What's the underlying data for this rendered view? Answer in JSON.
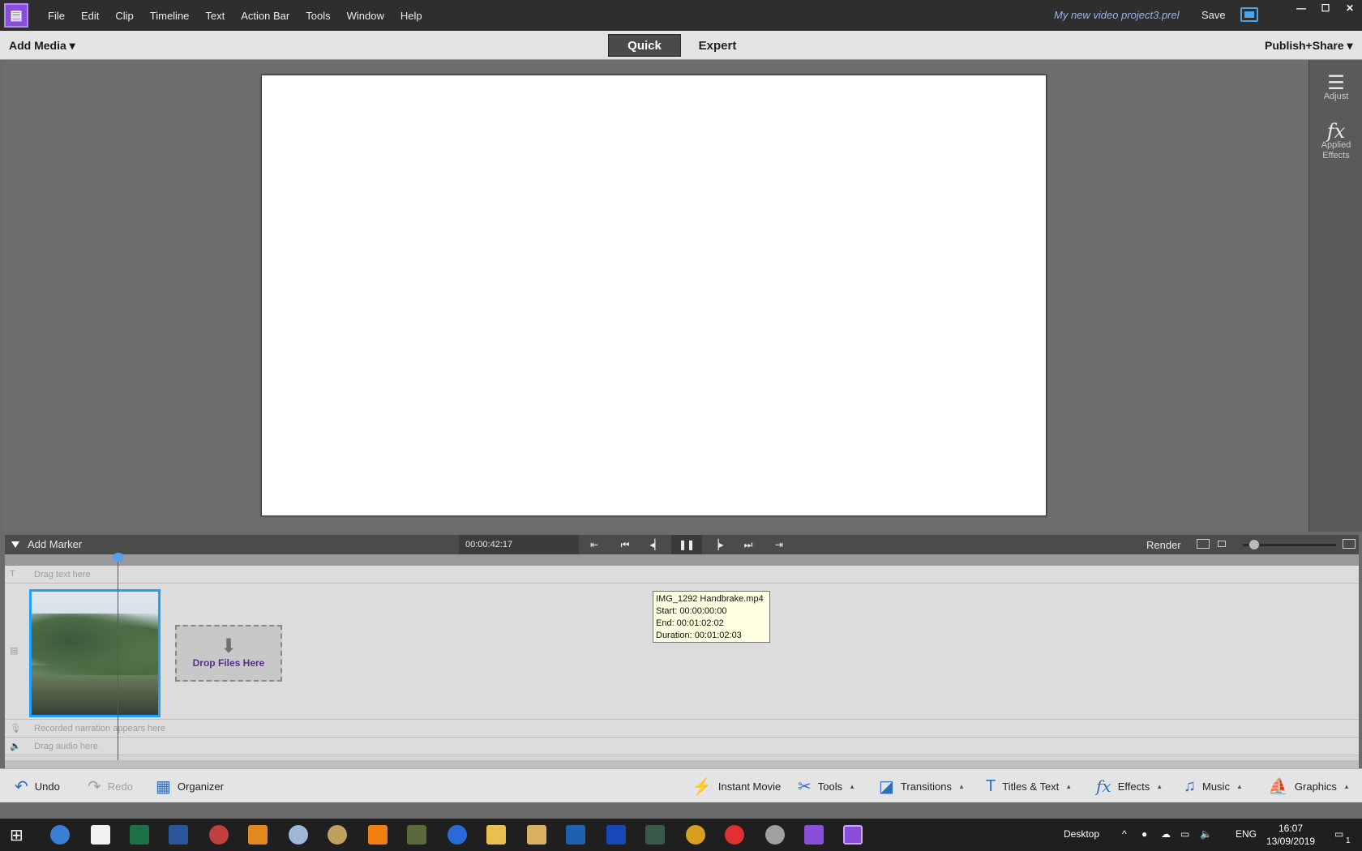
{
  "window": {
    "project_name": "My new video project3.prel",
    "save_label": "Save",
    "minimize": "—",
    "maximize": "☐",
    "close": "✕"
  },
  "menu": {
    "items": [
      {
        "label": "File"
      },
      {
        "label": "Edit"
      },
      {
        "label": "Clip"
      },
      {
        "label": "Timeline"
      },
      {
        "label": "Text"
      },
      {
        "label": "Action Bar"
      },
      {
        "label": "Tools"
      },
      {
        "label": "Window"
      },
      {
        "label": "Help"
      }
    ]
  },
  "modebar": {
    "add_media": "Add Media ▾",
    "tabs": [
      {
        "label": "Quick",
        "active": true
      },
      {
        "label": "Expert",
        "active": false
      }
    ],
    "publish": "Publish+Share ▾"
  },
  "right_panel": {
    "adjust": "Adjust",
    "applied_effects_1": "Applied",
    "applied_effects_2": "Effects"
  },
  "transport": {
    "add_marker": "Add Marker",
    "timecode": "00:00:42:17",
    "render": "Render"
  },
  "timeline": {
    "text_track": "Drag text here",
    "narration_track": "Recorded narration appears here",
    "audio_track": "Drag audio here",
    "drop_files": "Drop Files Here"
  },
  "tooltip": {
    "name": "IMG_1292 Handbrake.mp4",
    "start": "Start: 00:00:00:00",
    "end": "End: 00:01:02:02",
    "duration": "Duration: 00:01:02:03"
  },
  "actionbar": {
    "undo": "Undo",
    "redo": "Redo",
    "organizer": "Organizer",
    "instant_movie": "Instant Movie",
    "tools": "Tools",
    "transitions": "Transitions",
    "titles_text": "Titles & Text",
    "effects": "Effects",
    "music": "Music",
    "graphics": "Graphics"
  },
  "taskbar": {
    "desktop": "Desktop",
    "lang": "ENG",
    "time": "16:07",
    "date": "13/09/2019",
    "notifications": "1"
  },
  "colors": {
    "accent": "#1ea0ff",
    "app_purple": "#8a4fd8",
    "playhead": "#e02020"
  }
}
